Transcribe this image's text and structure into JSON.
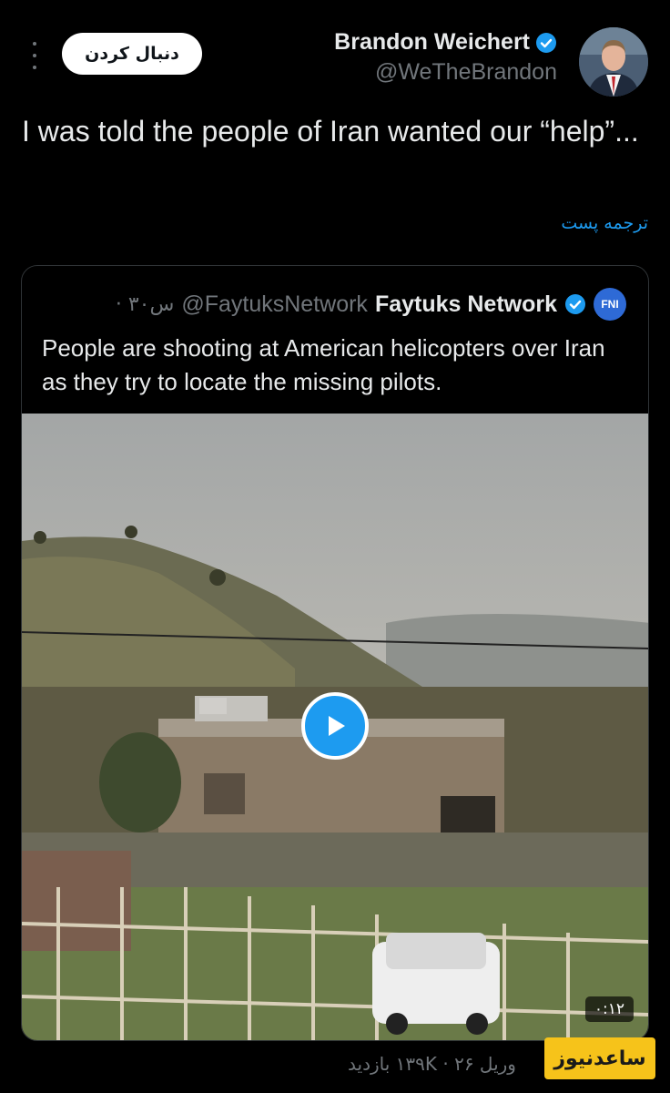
{
  "header": {
    "follow_label": "دنبال کردن",
    "author_name": "Brandon Weichert",
    "author_handle": "@WeTheBrandon"
  },
  "tweet": {
    "text": "I was told the people of Iran wanted our “help”...",
    "translate_label": "ترجمه پست"
  },
  "quote": {
    "name": "Faytuks Network",
    "handle": "@FaytuksNetwork",
    "time": "· ۳۰س",
    "logo_text": "FNI",
    "text": "People are shooting at American helicopters over Iran as they try to locate the missing pilots.",
    "video_duration": "۰:۱۲"
  },
  "footer": {
    "meta": "وریل ۲۶ · ۱۳۹K بازدید"
  },
  "watermark": {
    "text": "ساعدنیوز"
  },
  "colors": {
    "background": "#000000",
    "accent": "#1d9bf0",
    "text_primary": "#e7e9ea",
    "text_secondary": "#71767b",
    "watermark_bg": "#f6c31a"
  },
  "icons": [
    "more-dots-icon",
    "verified-badge-icon",
    "play-icon"
  ]
}
